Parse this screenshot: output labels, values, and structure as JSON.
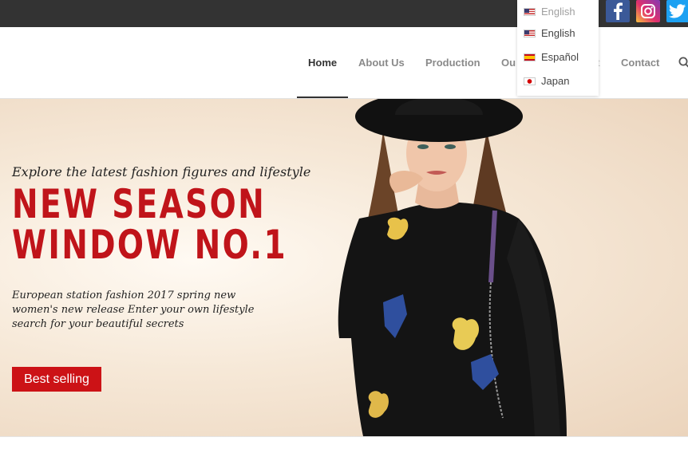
{
  "language_menu": {
    "current": "English",
    "options": [
      {
        "label": "English",
        "flag": "us-flag-icon"
      },
      {
        "label": "Español",
        "flag": "es-flag-icon"
      },
      {
        "label": "Japan",
        "flag": "jp-flag-icon"
      }
    ]
  },
  "social": [
    "facebook-icon",
    "instagram-icon",
    "twitter-icon"
  ],
  "nav": {
    "items": [
      "Home",
      "About Us",
      "Production",
      "Ou",
      "t",
      "Contact"
    ],
    "active": "Home"
  },
  "hero": {
    "kicker": "Explore the latest fashion figures and lifestyle",
    "headline_line1": "NEW SEASON",
    "headline_line2": "WINDOW NO.1",
    "description": "European station fashion 2017 spring new women's new release Enter your own lifestyle search for your beautiful secrets",
    "cta_label": "Best selling"
  },
  "colors": {
    "topbar": "#333333",
    "accent_red": "#c0141a",
    "button_red": "#cc1216"
  }
}
